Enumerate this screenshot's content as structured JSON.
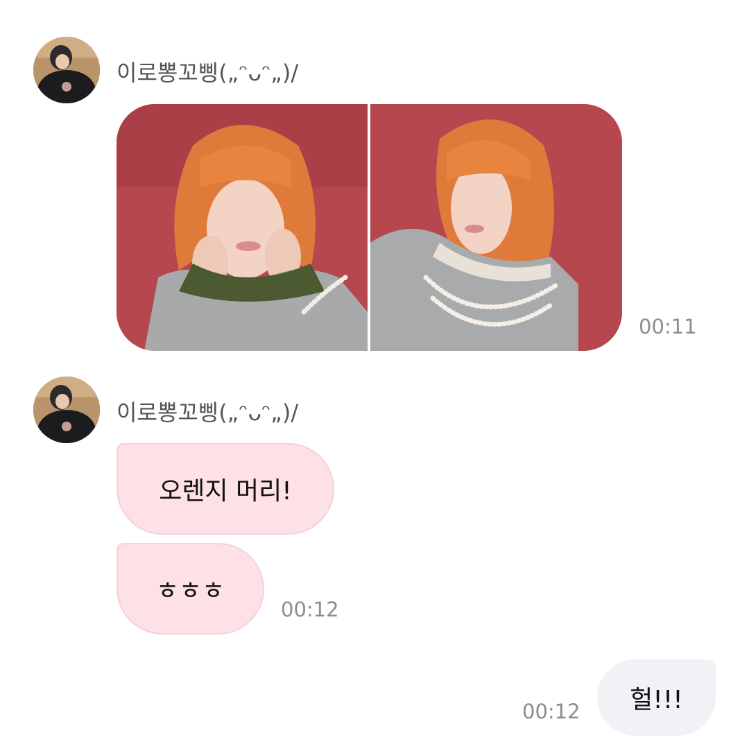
{
  "messages": {
    "group1": {
      "sender": "이로뽕꼬삥(„ᵔᴗᵔ„)/",
      "time": "00:11"
    },
    "group2": {
      "sender": "이로뽕꼬삥(„ᵔᴗᵔ„)/",
      "bubble1": "오렌지 머리!",
      "bubble2": "ㅎㅎㅎ",
      "time": "00:12"
    },
    "mine": {
      "text": "헐!!!",
      "time": "00:12"
    }
  },
  "colors": {
    "incoming_bubble": "#fde1e6",
    "outgoing_bubble": "#f2f2f6",
    "photo_background": "#b5474e",
    "hair": "#e07a3a"
  }
}
